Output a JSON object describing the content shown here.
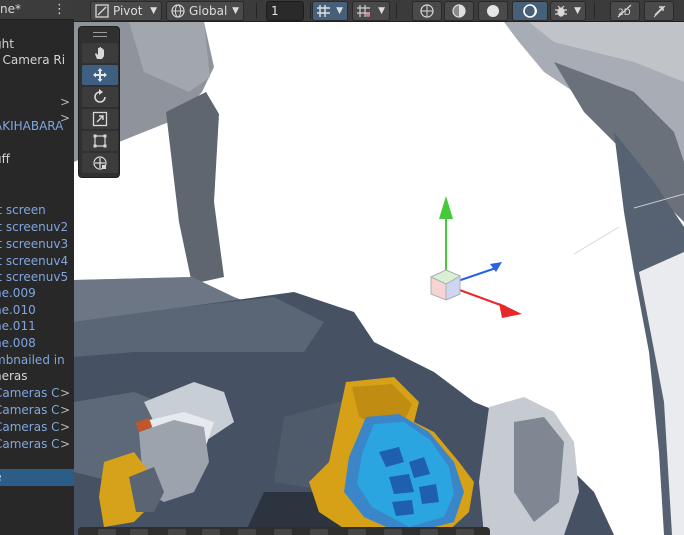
{
  "hierarchy": {
    "title": "ne*",
    "items": [
      {
        "label": "ght",
        "tone": "white",
        "arrow": ""
      },
      {
        "label": "] Camera Ri",
        "tone": "white",
        "arrow": ""
      },
      {
        "label": "",
        "tone": "white",
        "arrow": ">"
      },
      {
        "label": "",
        "tone": "white",
        "arrow": ">"
      },
      {
        "label": "AKIHABARA",
        "tone": "blue",
        "arrow": ""
      },
      {
        "label": "",
        "tone": "white",
        "arrow": ""
      },
      {
        "label": "uff",
        "tone": "white",
        "arrow": ""
      },
      {
        "label": "",
        "tone": "white",
        "arrow": ""
      },
      {
        "label": "",
        "tone": "white",
        "arrow": ""
      },
      {
        "label": "it screen",
        "tone": "blue",
        "arrow": ""
      },
      {
        "label": "it screenuv2",
        "tone": "blue",
        "arrow": ""
      },
      {
        "label": "it screenuv3",
        "tone": "blue",
        "arrow": ""
      },
      {
        "label": "it screenuv4",
        "tone": "blue",
        "arrow": ""
      },
      {
        "label": "it screenuv5",
        "tone": "blue",
        "arrow": ""
      },
      {
        "label": "ne.009",
        "tone": "blue",
        "arrow": ""
      },
      {
        "label": "ne.010",
        "tone": "blue",
        "arrow": ""
      },
      {
        "label": "ne.011",
        "tone": "blue",
        "arrow": ""
      },
      {
        "label": "ne.008",
        "tone": "blue",
        "arrow": ""
      },
      {
        "label": "mbnailed in",
        "tone": "blue",
        "arrow": ""
      },
      {
        "label": "neras",
        "tone": "white",
        "arrow": ""
      },
      {
        "label": "Cameras C",
        "tone": "blue",
        "arrow": ">"
      },
      {
        "label": "Cameras C",
        "tone": "blue",
        "arrow": ">"
      },
      {
        "label": "Cameras C",
        "tone": "blue",
        "arrow": ">"
      },
      {
        "label": "Cameras C",
        "tone": "blue",
        "arrow": ">"
      },
      {
        "label": "",
        "tone": "white",
        "arrow": ""
      },
      {
        "label": "",
        "tone": "white",
        "arrow": ""
      },
      {
        "label": "e",
        "tone": "selected",
        "arrow": ""
      }
    ]
  },
  "toolbar": {
    "pivot_label": "Pivot",
    "global_label": "Global",
    "grid_snap_value": "1"
  },
  "colors": {
    "x_axis": "#e8292c",
    "y_axis": "#45c93a",
    "z_axis": "#2a62e6",
    "selection": "#2c5d87"
  }
}
